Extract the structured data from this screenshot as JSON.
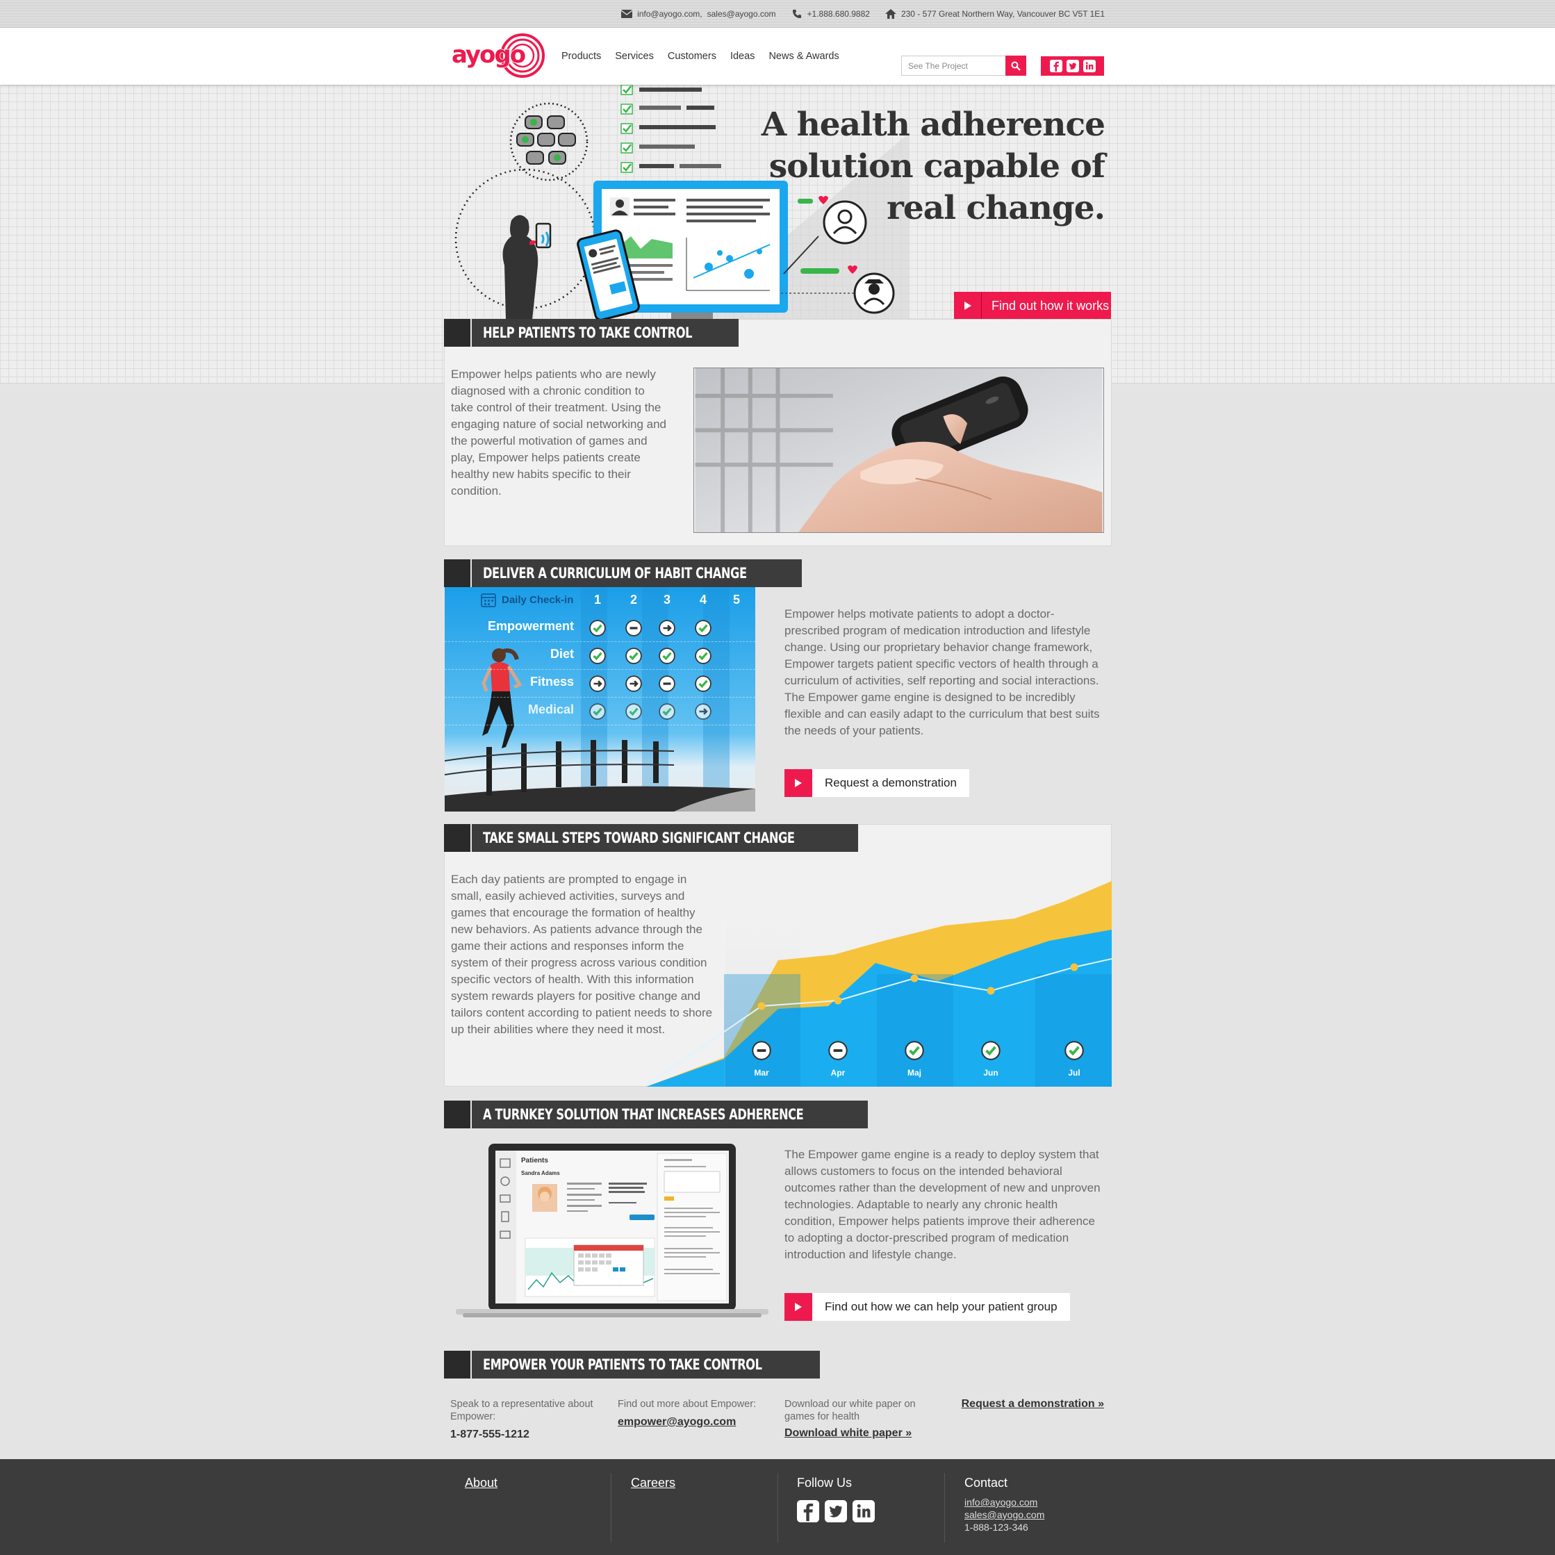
{
  "topbar": {
    "email1": "info@ayogo.com,",
    "email2": "sales@ayogo.com",
    "phone": "+1.888.680.9882",
    "address": "230 - 577 Great Northern Way, Vancouver BC V5T 1E1"
  },
  "header": {
    "logo_text": "ayogo",
    "nav": [
      "Products",
      "Services",
      "Customers",
      "Ideas",
      "News & Awards"
    ],
    "search_placeholder": "See The Project"
  },
  "hero": {
    "title_line1": "A health adherence",
    "title_line2": "solution capable of",
    "title_line3": "real change.",
    "cta": "Find out how it works"
  },
  "section1": {
    "heading": "HELP PATIENTS TO TAKE CONTROL",
    "text": "Empower helps patients who are newly diagnosed with a chronic condition to take control of their treatment. Using the engaging nature of social networking and the powerful motivation of games and play, Empower helps patients create healthy new habits specific to their condition."
  },
  "section2": {
    "heading": "DELIVER A CURRICULUM OF HABIT CHANGE",
    "grid_title": "Daily Check-in",
    "days": [
      "1",
      "2",
      "3",
      "4",
      "5"
    ],
    "rows": [
      {
        "label": "Empowerment",
        "states": [
          "check",
          "minus",
          "arrow",
          "check",
          ""
        ]
      },
      {
        "label": "Diet",
        "states": [
          "check",
          "check",
          "check",
          "check",
          ""
        ]
      },
      {
        "label": "Fitness",
        "states": [
          "arrow",
          "arrow",
          "minus",
          "check",
          ""
        ]
      },
      {
        "label": "Medical",
        "states": [
          "check",
          "check",
          "check",
          "arrow",
          ""
        ]
      }
    ],
    "text": "Empower helps motivate patients to adopt a doctor-prescribed program of medication introduction and lifestyle change. Using our proprietary behavior change framework, Empower targets patient specific vectors of health through a curriculum of activities, self reporting and social interactions. The Empower game engine is designed to be incredibly flexible and can easily adapt to the curriculum that best suits the needs of your patients.",
    "cta": "Request a demonstration"
  },
  "section3": {
    "heading": "TAKE SMALL STEPS TOWARD SIGNIFICANT CHANGE",
    "text": "Each day patients are prompted to engage in small, easily achieved activities, surveys and games that encourage the formation of healthy new behaviors. As patients advance through the game their actions and responses inform the system of their progress across various condition specific vectors of health. With this information system rewards players for positive change and tailors content according to patient needs to shore up their abilities where they need it most.",
    "months": [
      "Mar",
      "Apr",
      "Maj",
      "Jun",
      "Jul"
    ],
    "states": [
      "minus",
      "minus",
      "check",
      "check",
      "check"
    ]
  },
  "section4": {
    "heading": "A TURNKEY SOLUTION THAT INCREASES ADHERENCE",
    "screen_title": "Patients",
    "patient_name": "Sandra Adams",
    "text": "The Empower game engine is a ready to deploy system that allows customers to focus on the intended behavioral outcomes rather than the development of new and unproven technologies. Adaptable to nearly any chronic health condition, Empower helps patients improve their adherence to adopting a doctor-prescribed program of medication introduction and lifestyle change.",
    "cta": "Find out how we can help your patient group"
  },
  "section5": {
    "heading": "EMPOWER YOUR PATIENTS TO TAKE CONTROL",
    "col1_label": "Speak to a representative about Empower:",
    "col1_value": "1-877-555-1212",
    "col2_label": "Find out more about Empower:",
    "col2_value": "empower@ayogo.com",
    "col3_label": "Download our white paper on games for health",
    "col3_value": "Download white paper »",
    "col4_value": "Request a demonstration »"
  },
  "footer": {
    "about": "About",
    "careers": "Careers",
    "follow": "Follow Us",
    "contact": "Contact",
    "contact_email1": "info@ayogo.com",
    "contact_email2": "sales@ayogo.com",
    "contact_phone": "1-888-123-346"
  },
  "colors": {
    "accent": "#ee1a4e",
    "dark": "#3c3c3c",
    "blue": "#1aa7ee",
    "yellow": "#f6c33c",
    "green": "#39b54a"
  }
}
